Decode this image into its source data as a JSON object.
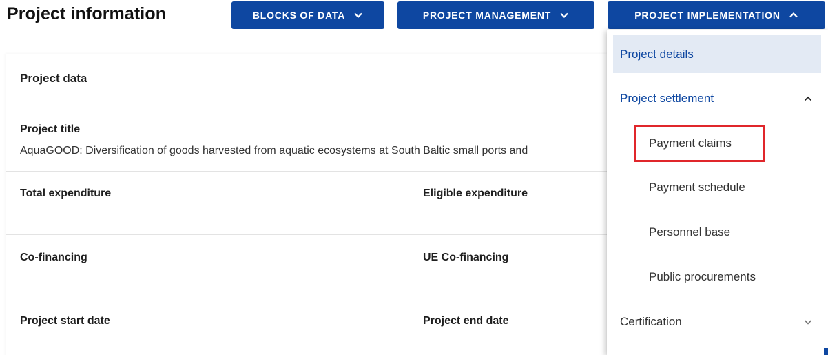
{
  "header": {
    "title": "Project information"
  },
  "nav": {
    "blocks_of_data": "BLOCKS OF DATA",
    "project_management": "PROJECT MANAGEMENT",
    "project_implementation": "PROJECT IMPLEMENTATION"
  },
  "card": {
    "title": "Project data",
    "project_title_label": "Project title",
    "project_title_value": "AquaGOOD: Diversification of goods harvested from aquatic ecosystems at South Baltic small ports and",
    "total_expenditure_label": "Total expenditure",
    "eligible_expenditure_label": "Eligible expenditure",
    "co_financing_label": "Co-financing",
    "ue_co_financing_label": "UE Co-financing",
    "start_date_label": "Project start date",
    "end_date_label": "Project end date"
  },
  "dropdown": {
    "project_details": "Project details",
    "project_settlement": "Project settlement",
    "payment_claims": "Payment claims",
    "payment_schedule": "Payment schedule",
    "personnel_base": "Personnel base",
    "public_procurements": "Public procurements",
    "certification": "Certification"
  },
  "icons": {
    "nav_chevron": "chevron-down-icon",
    "impl_chevron": "chevron-up-icon",
    "settlement_chevron": "chevron-up-icon",
    "certification_chevron": "chevron-down-icon"
  },
  "colors": {
    "primary": "#0e47a1",
    "active_bg": "#e3eaf4",
    "highlight": "#e0262b"
  }
}
